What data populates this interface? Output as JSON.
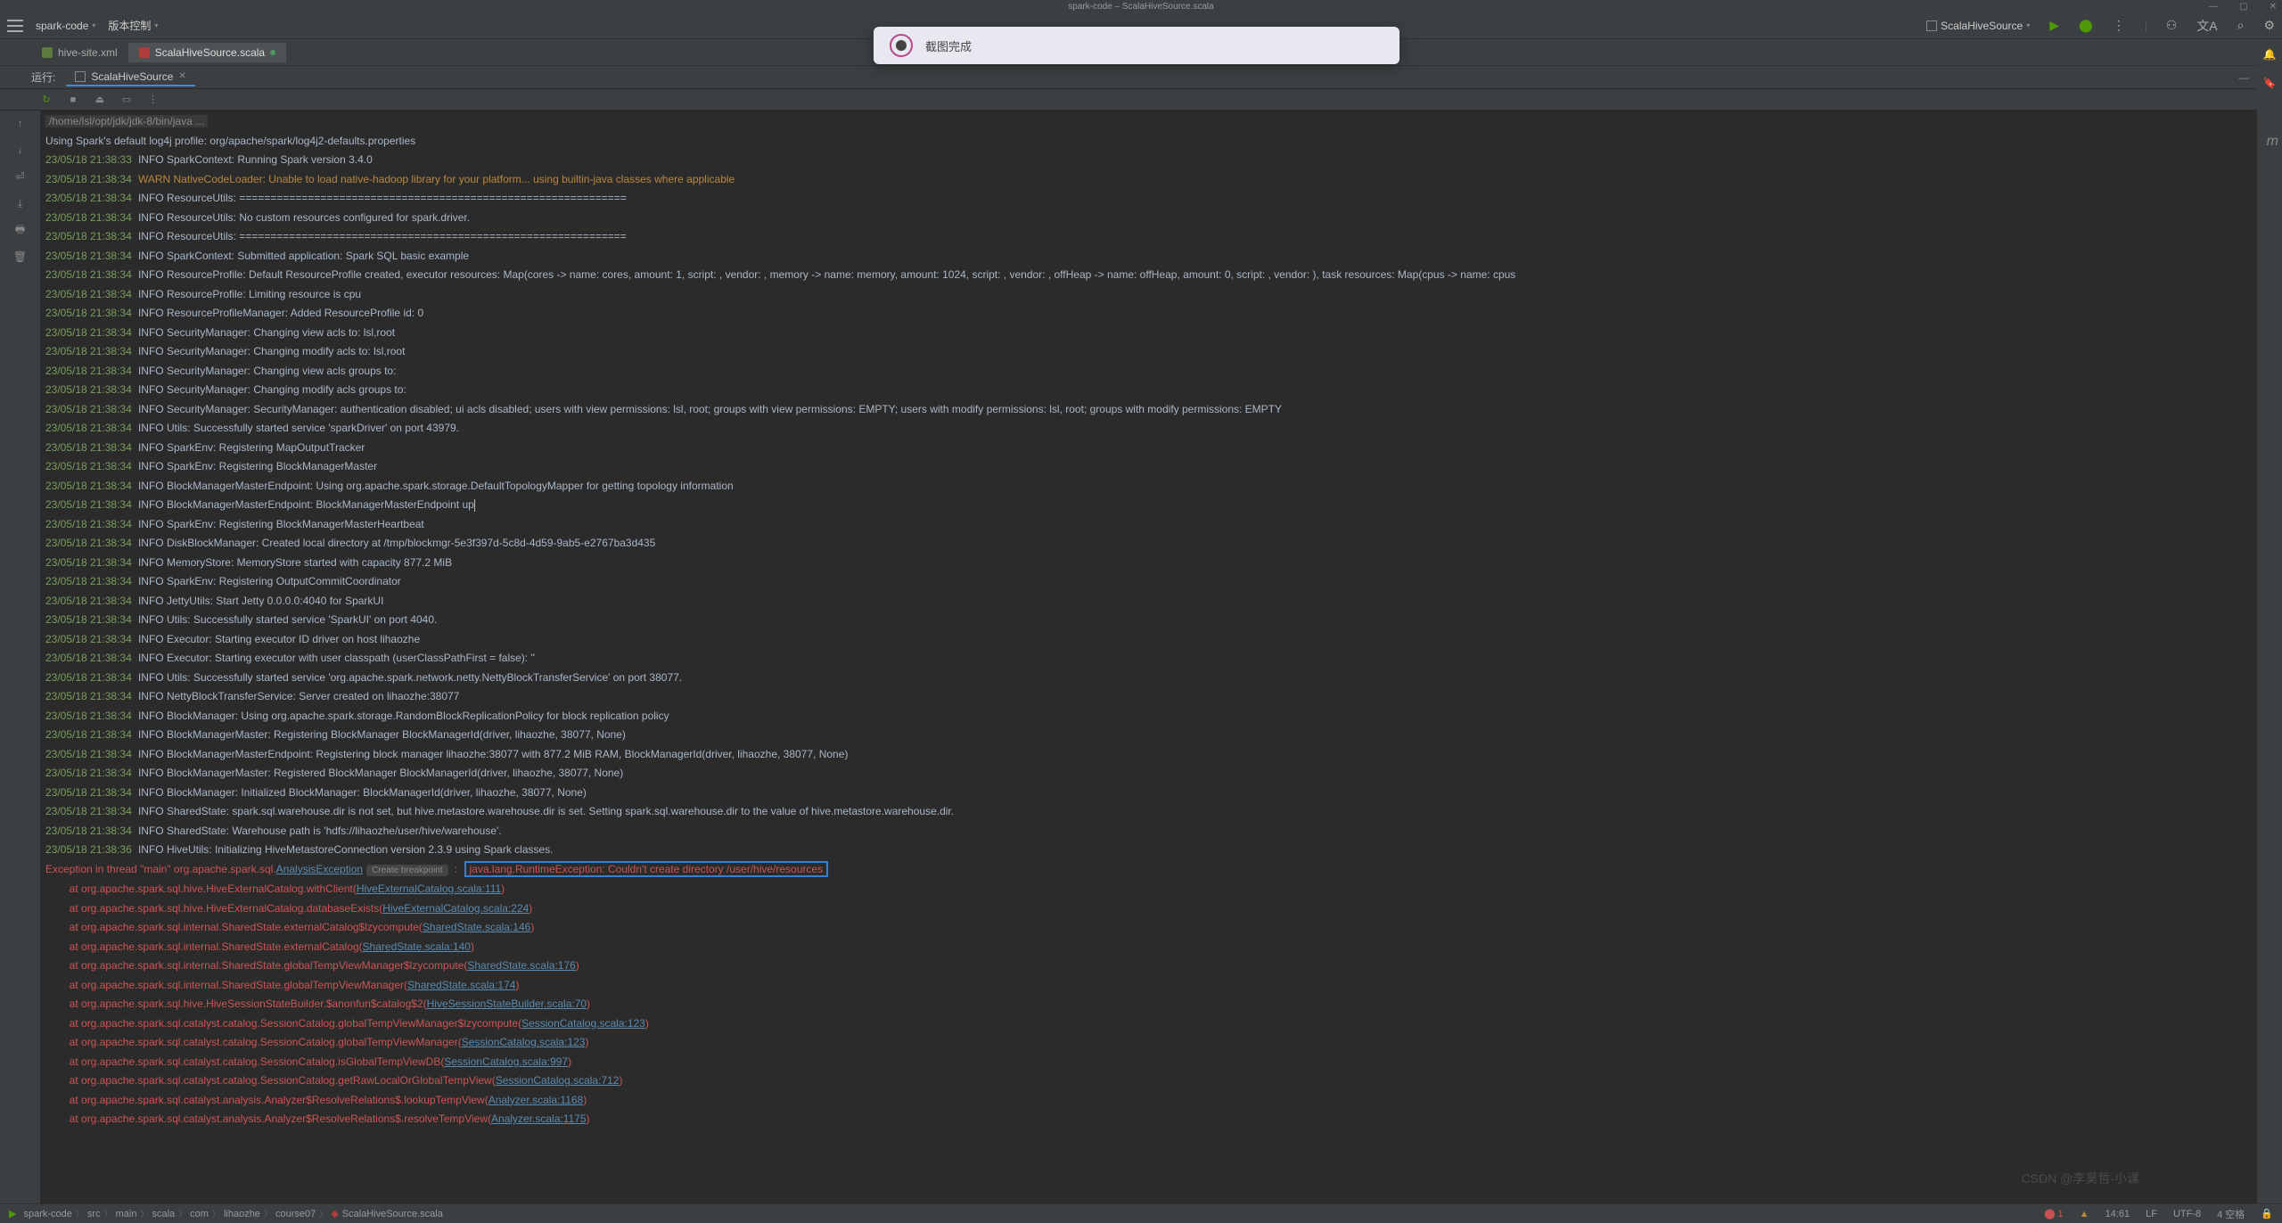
{
  "title": "spark-code – ScalaHiveSource.scala",
  "winctrl": {
    "min": "—",
    "max": "▢",
    "close": "✕"
  },
  "project": "spark-code",
  "vcs": "版本控制",
  "runconfig": "ScalaHiveSource",
  "filetabs": [
    {
      "name": "hive-site.xml",
      "icon": "xml"
    },
    {
      "name": "ScalaHiveSource.scala",
      "icon": "sc"
    }
  ],
  "run_label": "运行:",
  "runtab": "ScalaHiveSource",
  "toast": "截图完成",
  "cmd": "/home/lsl/opt/jdk/jdk-8/bin/java ...",
  "log": [
    {
      "t": "",
      "l": "info",
      "m": "Using Spark's default log4j profile: org/apache/spark/log4j2-defaults.properties"
    },
    {
      "t": "23/05/18 21:38:33",
      "l": "info",
      "m": "INFO SparkContext: Running Spark version 3.4.0"
    },
    {
      "t": "23/05/18 21:38:34",
      "l": "warn",
      "m": "WARN NativeCodeLoader: Unable to load native-hadoop library for your platform... using builtin-java classes where applicable"
    },
    {
      "t": "23/05/18 21:38:34",
      "l": "info",
      "m": "INFO ResourceUtils: =============================================================="
    },
    {
      "t": "23/05/18 21:38:34",
      "l": "info",
      "m": "INFO ResourceUtils: No custom resources configured for spark.driver."
    },
    {
      "t": "23/05/18 21:38:34",
      "l": "info",
      "m": "INFO ResourceUtils: =============================================================="
    },
    {
      "t": "23/05/18 21:38:34",
      "l": "info",
      "m": "INFO SparkContext: Submitted application: Spark SQL basic example"
    },
    {
      "t": "23/05/18 21:38:34",
      "l": "info",
      "m": "INFO ResourceProfile: Default ResourceProfile created, executor resources: Map(cores -> name: cores, amount: 1, script: , vendor: , memory -> name: memory, amount: 1024, script: , vendor: , offHeap -> name: offHeap, amount: 0, script: , vendor: ), task resources: Map(cpus -> name: cpus"
    },
    {
      "t": "23/05/18 21:38:34",
      "l": "info",
      "m": "INFO ResourceProfile: Limiting resource is cpu"
    },
    {
      "t": "23/05/18 21:38:34",
      "l": "info",
      "m": "INFO ResourceProfileManager: Added ResourceProfile id: 0"
    },
    {
      "t": "23/05/18 21:38:34",
      "l": "info",
      "m": "INFO SecurityManager: Changing view acls to: lsl,root"
    },
    {
      "t": "23/05/18 21:38:34",
      "l": "info",
      "m": "INFO SecurityManager: Changing modify acls to: lsl,root"
    },
    {
      "t": "23/05/18 21:38:34",
      "l": "info",
      "m": "INFO SecurityManager: Changing view acls groups to:"
    },
    {
      "t": "23/05/18 21:38:34",
      "l": "info",
      "m": "INFO SecurityManager: Changing modify acls groups to:"
    },
    {
      "t": "23/05/18 21:38:34",
      "l": "info",
      "m": "INFO SecurityManager: SecurityManager: authentication disabled; ui acls disabled; users with view permissions: lsl, root; groups with view permissions: EMPTY; users with modify permissions: lsl, root; groups with modify permissions: EMPTY"
    },
    {
      "t": "23/05/18 21:38:34",
      "l": "info",
      "m": "INFO Utils: Successfully started service 'sparkDriver' on port 43979."
    },
    {
      "t": "23/05/18 21:38:34",
      "l": "info",
      "m": "INFO SparkEnv: Registering MapOutputTracker"
    },
    {
      "t": "23/05/18 21:38:34",
      "l": "info",
      "m": "INFO SparkEnv: Registering BlockManagerMaster"
    },
    {
      "t": "23/05/18 21:38:34",
      "l": "info",
      "m": "INFO BlockManagerMasterEndpoint: Using org.apache.spark.storage.DefaultTopologyMapper for getting topology information"
    },
    {
      "t": "23/05/18 21:38:34",
      "l": "info",
      "m": "INFO BlockManagerMasterEndpoint: BlockManagerMasterEndpoint up",
      "cursor": true
    },
    {
      "t": "23/05/18 21:38:34",
      "l": "info",
      "m": "INFO SparkEnv: Registering BlockManagerMasterHeartbeat"
    },
    {
      "t": "23/05/18 21:38:34",
      "l": "info",
      "m": "INFO DiskBlockManager: Created local directory at /tmp/blockmgr-5e3f397d-5c8d-4d59-9ab5-e2767ba3d435"
    },
    {
      "t": "23/05/18 21:38:34",
      "l": "info",
      "m": "INFO MemoryStore: MemoryStore started with capacity 877.2 MiB"
    },
    {
      "t": "23/05/18 21:38:34",
      "l": "info",
      "m": "INFO SparkEnv: Registering OutputCommitCoordinator"
    },
    {
      "t": "23/05/18 21:38:34",
      "l": "info",
      "m": "INFO JettyUtils: Start Jetty 0.0.0.0:4040 for SparkUI"
    },
    {
      "t": "23/05/18 21:38:34",
      "l": "info",
      "m": "INFO Utils: Successfully started service 'SparkUI' on port 4040."
    },
    {
      "t": "23/05/18 21:38:34",
      "l": "info",
      "m": "INFO Executor: Starting executor ID driver on host lihaozhe"
    },
    {
      "t": "23/05/18 21:38:34",
      "l": "info",
      "m": "INFO Executor: Starting executor with user classpath (userClassPathFirst = false): ''"
    },
    {
      "t": "23/05/18 21:38:34",
      "l": "info",
      "m": "INFO Utils: Successfully started service 'org.apache.spark.network.netty.NettyBlockTransferService' on port 38077."
    },
    {
      "t": "23/05/18 21:38:34",
      "l": "info",
      "m": "INFO NettyBlockTransferService: Server created on lihaozhe:38077"
    },
    {
      "t": "23/05/18 21:38:34",
      "l": "info",
      "m": "INFO BlockManager: Using org.apache.spark.storage.RandomBlockReplicationPolicy for block replication policy"
    },
    {
      "t": "23/05/18 21:38:34",
      "l": "info",
      "m": "INFO BlockManagerMaster: Registering BlockManager BlockManagerId(driver, lihaozhe, 38077, None)"
    },
    {
      "t": "23/05/18 21:38:34",
      "l": "info",
      "m": "INFO BlockManagerMasterEndpoint: Registering block manager lihaozhe:38077 with 877.2 MiB RAM, BlockManagerId(driver, lihaozhe, 38077, None)"
    },
    {
      "t": "23/05/18 21:38:34",
      "l": "info",
      "m": "INFO BlockManagerMaster: Registered BlockManager BlockManagerId(driver, lihaozhe, 38077, None)"
    },
    {
      "t": "23/05/18 21:38:34",
      "l": "info",
      "m": "INFO BlockManager: Initialized BlockManager: BlockManagerId(driver, lihaozhe, 38077, None)"
    },
    {
      "t": "23/05/18 21:38:34",
      "l": "info",
      "m": "INFO SharedState: spark.sql.warehouse.dir is not set, but hive.metastore.warehouse.dir is set. Setting spark.sql.warehouse.dir to the value of hive.metastore.warehouse.dir."
    },
    {
      "t": "23/05/18 21:38:34",
      "l": "info",
      "m": "INFO SharedState: Warehouse path is 'hdfs://lihaozhe/user/hive/warehouse'."
    },
    {
      "t": "23/05/18 21:38:36",
      "l": "info",
      "m": "INFO HiveUtils: Initializing HiveMetastoreConnection version 2.3.9 using Spark classes."
    }
  ],
  "exc": {
    "head": "Exception in thread \"main\" org.apache.spark.sql.",
    "cls": "AnalysisException",
    "bp": "Create breakpoint",
    "sep": " : ",
    "msg": "java.lang.RuntimeException: Couldn't create directory /user/hive/resources"
  },
  "stack": [
    {
      "p": "        at org.apache.spark.sql.hive.HiveExternalCatalog.withClient(",
      "lk": "HiveExternalCatalog.scala:111",
      "s": ")"
    },
    {
      "p": "        at org.apache.spark.sql.hive.HiveExternalCatalog.databaseExists(",
      "lk": "HiveExternalCatalog.scala:224",
      "s": ")"
    },
    {
      "p": "        at org.apache.spark.sql.internal.SharedState.externalCatalog$lzycompute(",
      "lk": "SharedState.scala:146",
      "s": ")"
    },
    {
      "p": "        at org.apache.spark.sql.internal.SharedState.externalCatalog(",
      "lk": "SharedState.scala:140",
      "s": ")"
    },
    {
      "p": "        at org.apache.spark.sql.internal.SharedState.globalTempViewManager$lzycompute(",
      "lk": "SharedState.scala:176",
      "s": ")"
    },
    {
      "p": "        at org.apache.spark.sql.internal.SharedState.globalTempViewManager(",
      "lk": "SharedState.scala:174",
      "s": ")"
    },
    {
      "p": "        at org.apache.spark.sql.hive.HiveSessionStateBuilder.$anonfun$catalog$2(",
      "lk": "HiveSessionStateBuilder.scala:70",
      "s": ")"
    },
    {
      "p": "        at org.apache.spark.sql.catalyst.catalog.SessionCatalog.globalTempViewManager$lzycompute(",
      "lk": "SessionCatalog.scala:123",
      "s": ")"
    },
    {
      "p": "        at org.apache.spark.sql.catalyst.catalog.SessionCatalog.globalTempViewManager(",
      "lk": "SessionCatalog.scala:123",
      "s": ")"
    },
    {
      "p": "        at org.apache.spark.sql.catalyst.catalog.SessionCatalog.isGlobalTempViewDB(",
      "lk": "SessionCatalog.scala:997",
      "s": ")"
    },
    {
      "p": "        at org.apache.spark.sql.catalyst.catalog.SessionCatalog.getRawLocalOrGlobalTempView(",
      "lk": "SessionCatalog.scala:712",
      "s": ")"
    },
    {
      "p": "        at org.apache.spark.sql.catalyst.analysis.Analyzer$ResolveRelations$.lookupTempView(",
      "lk": "Analyzer.scala:1168",
      "s": ")"
    },
    {
      "p": "        at org.apache.spark.sql.catalyst.analysis.Analyzer$ResolveRelations$.resolveTempView(",
      "lk": "Analyzer.scala:1175",
      "s": ")"
    }
  ],
  "breadcrumb": [
    "spark-code",
    "src",
    "main",
    "scala",
    "com",
    "lihaozhe",
    "course07",
    "ScalaHiveSource.scala"
  ],
  "status": {
    "pos": "14:61",
    "enc": "LF",
    "sp": "UTF-8",
    "ind": "4 空格"
  },
  "csdn": "CSDN @李昊哲-小课"
}
